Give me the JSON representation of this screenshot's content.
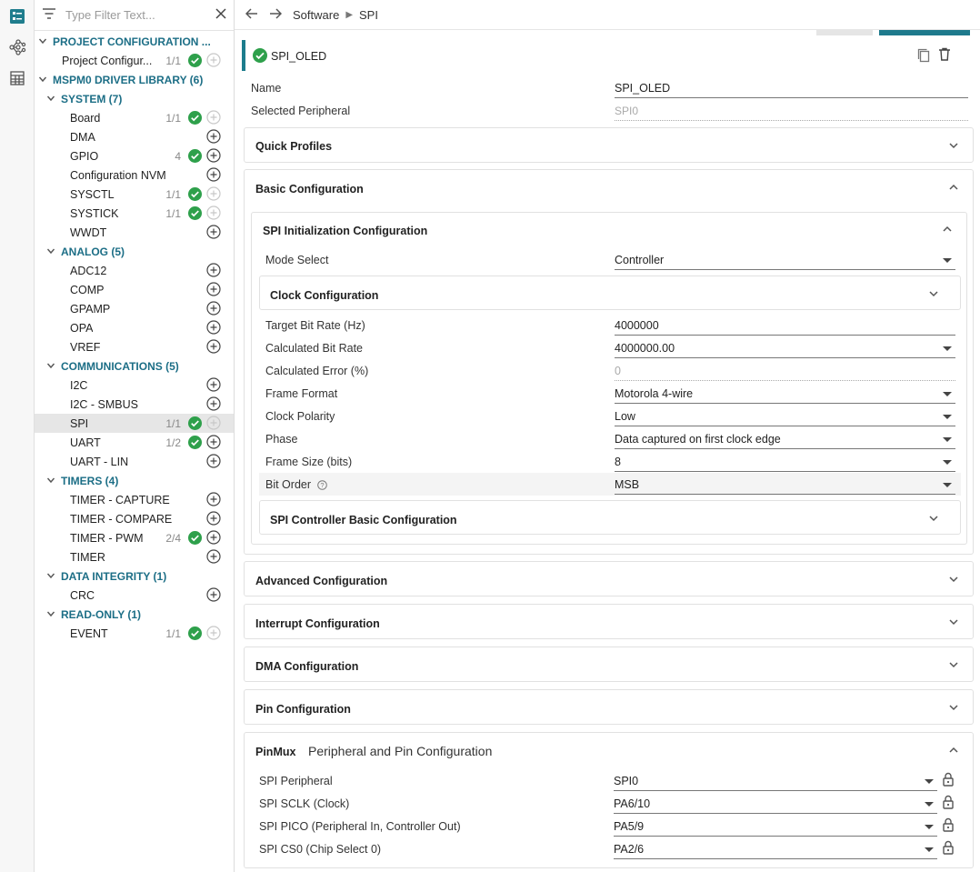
{
  "sidebar": {
    "filter_placeholder": "Type Filter Text...",
    "categories": [
      {
        "label": "PROJECT CONFIGURATION ...",
        "items": [
          {
            "label": "Project Configur...",
            "count": "1/1"
          }
        ]
      },
      {
        "label": "MSPM0 DRIVER LIBRARY (6)"
      },
      {
        "label": "SYSTEM (7)",
        "items": [
          {
            "label": "Board",
            "count": "1/1"
          },
          {
            "label": "DMA",
            "count": ""
          },
          {
            "label": "GPIO",
            "count": "4"
          },
          {
            "label": "Configuration NVM",
            "count": ""
          },
          {
            "label": "SYSCTL",
            "count": "1/1"
          },
          {
            "label": "SYSTICK",
            "count": "1/1"
          },
          {
            "label": "WWDT",
            "count": ""
          }
        ]
      },
      {
        "label": "ANALOG (5)",
        "items": [
          {
            "label": "ADC12"
          },
          {
            "label": "COMP"
          },
          {
            "label": "GPAMP"
          },
          {
            "label": "OPA"
          },
          {
            "label": "VREF"
          }
        ]
      },
      {
        "label": "COMMUNICATIONS (5)",
        "items": [
          {
            "label": "I2C",
            "count": ""
          },
          {
            "label": "I2C - SMBUS",
            "count": ""
          },
          {
            "label": "SPI",
            "count": "1/1"
          },
          {
            "label": "UART",
            "count": "1/2"
          },
          {
            "label": "UART - LIN",
            "count": ""
          }
        ]
      },
      {
        "label": "TIMERS (4)",
        "items": [
          {
            "label": "TIMER - CAPTURE",
            "count": ""
          },
          {
            "label": "TIMER - COMPARE",
            "count": ""
          },
          {
            "label": "TIMER - PWM",
            "count": "2/4"
          },
          {
            "label": "TIMER",
            "count": ""
          }
        ]
      },
      {
        "label": "DATA INTEGRITY (1)",
        "items": [
          {
            "label": "CRC",
            "count": ""
          }
        ]
      },
      {
        "label": "READ-ONLY (1)",
        "items": [
          {
            "label": "EVENT",
            "count": "1/1"
          }
        ]
      }
    ]
  },
  "breadcrumb": {
    "part1": "Software",
    "part2": "SPI"
  },
  "instance": {
    "name": "SPI_OLED",
    "name_label": "Name",
    "name_value": "SPI_OLED",
    "peripheral_label": "Selected Peripheral",
    "peripheral_value": "SPI0"
  },
  "sections": {
    "quick_profiles": "Quick Profiles",
    "basic": "Basic Configuration",
    "spi_init": "SPI Initialization Configuration",
    "clock": "Clock Configuration",
    "spi_controller_basic": "SPI Controller Basic Configuration",
    "advanced": "Advanced Configuration",
    "interrupt": "Interrupt Configuration",
    "dma": "DMA Configuration",
    "pin": "Pin Configuration",
    "pinmux_bold": "PinMux",
    "pinmux_rest": "Peripheral and Pin Configuration"
  },
  "fields": {
    "mode_label": "Mode Select",
    "mode_value": "Controller",
    "target_label": "Target Bit Rate (Hz)",
    "target_value": "4000000",
    "calc_label": "Calculated Bit Rate",
    "calc_value": "4000000.00",
    "err_label": "Calculated Error (%)",
    "err_value": "0",
    "format_label": "Frame Format",
    "format_value": "Motorola 4-wire",
    "polarity_label": "Clock Polarity",
    "polarity_value": "Low",
    "phase_label": "Phase",
    "phase_value": "Data captured on first clock edge",
    "size_label": "Frame Size (bits)",
    "size_value": "8",
    "order_label": "Bit Order",
    "order_value": "MSB"
  },
  "pinmux": {
    "periph_label": "SPI Peripheral",
    "periph_value": "SPI0",
    "sclk_label": "SPI SCLK (Clock)",
    "sclk_value": "PA6/10",
    "pico_label": "SPI PICO (Peripheral In, Controller Out)",
    "pico_value": "PA5/9",
    "cs0_label": "SPI CS0 (Chip Select 0)",
    "cs0_value": "PA2/6"
  },
  "colors": {
    "accent": "#1c7c8c",
    "ok": "#2ea04b",
    "category": "#1c6e86"
  }
}
